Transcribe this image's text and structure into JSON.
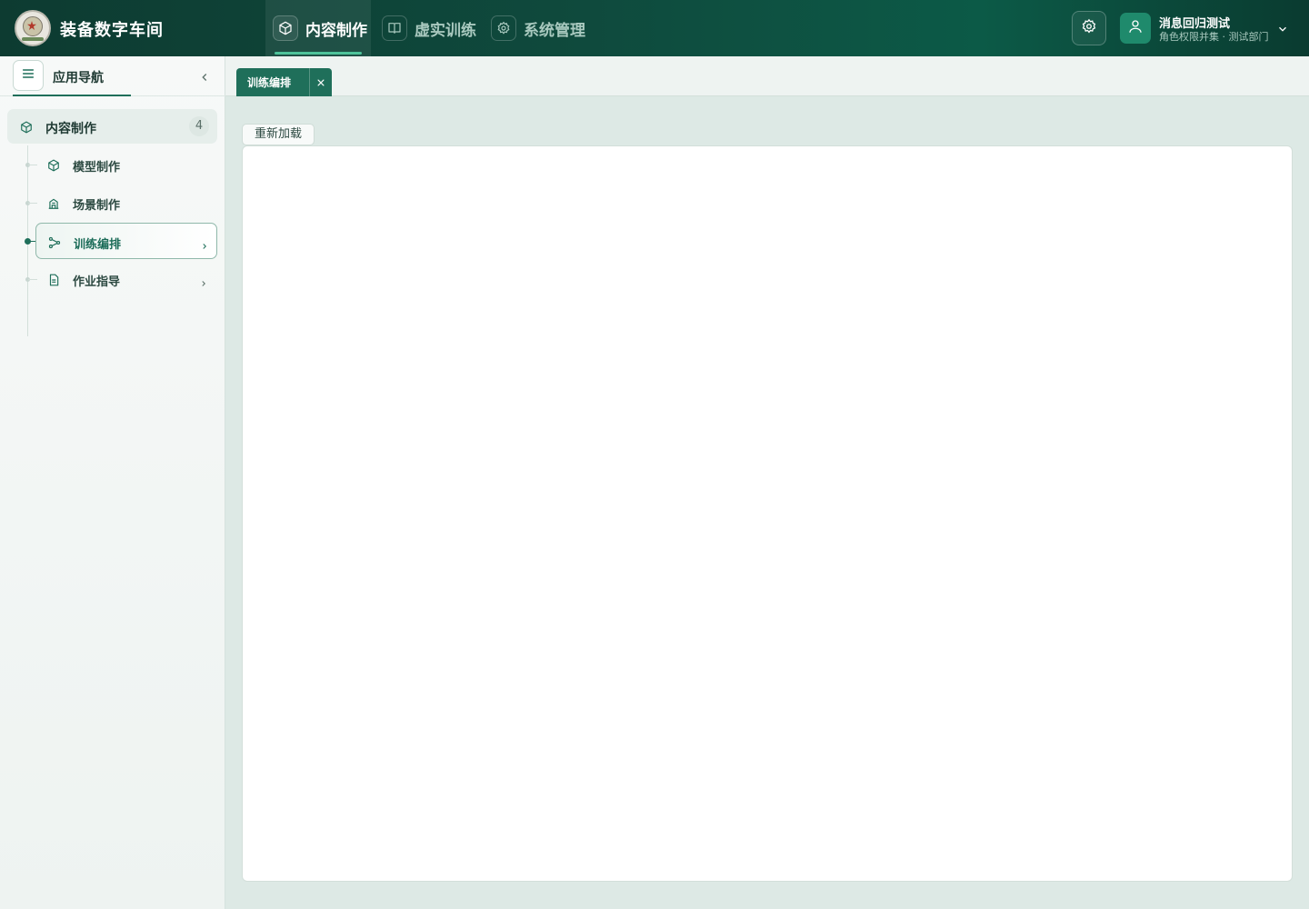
{
  "app": {
    "title": "装备数字车间"
  },
  "top_nav": {
    "items": [
      {
        "label": "内容制作",
        "icon": "box-icon",
        "active": true
      },
      {
        "label": "虚实训练",
        "icon": "book-icon",
        "active": false
      },
      {
        "label": "系统管理",
        "icon": "gear-icon",
        "active": false
      }
    ]
  },
  "user": {
    "name": "消息回归测试",
    "role": "角色权限并集 · 测试部门"
  },
  "sidebar": {
    "title": "应用导航",
    "group": {
      "label": "内容制作",
      "count": "4"
    },
    "items": [
      {
        "label": "模型制作",
        "icon": "cube-icon",
        "active": false,
        "has_children": false
      },
      {
        "label": "场景制作",
        "icon": "building-icon",
        "active": false,
        "has_children": false
      },
      {
        "label": "训练编排",
        "icon": "flow-icon",
        "active": true,
        "has_children": true
      },
      {
        "label": "作业指导",
        "icon": "document-icon",
        "active": false,
        "has_children": true
      }
    ]
  },
  "tabs": {
    "open": [
      {
        "label": "训练编排",
        "active": true
      }
    ]
  },
  "content": {
    "reload_label": "重新加载"
  },
  "colors": {
    "accent": "#1f6f5a",
    "header_bg": "#0f4a3d",
    "highlight": "#4ec39a"
  }
}
